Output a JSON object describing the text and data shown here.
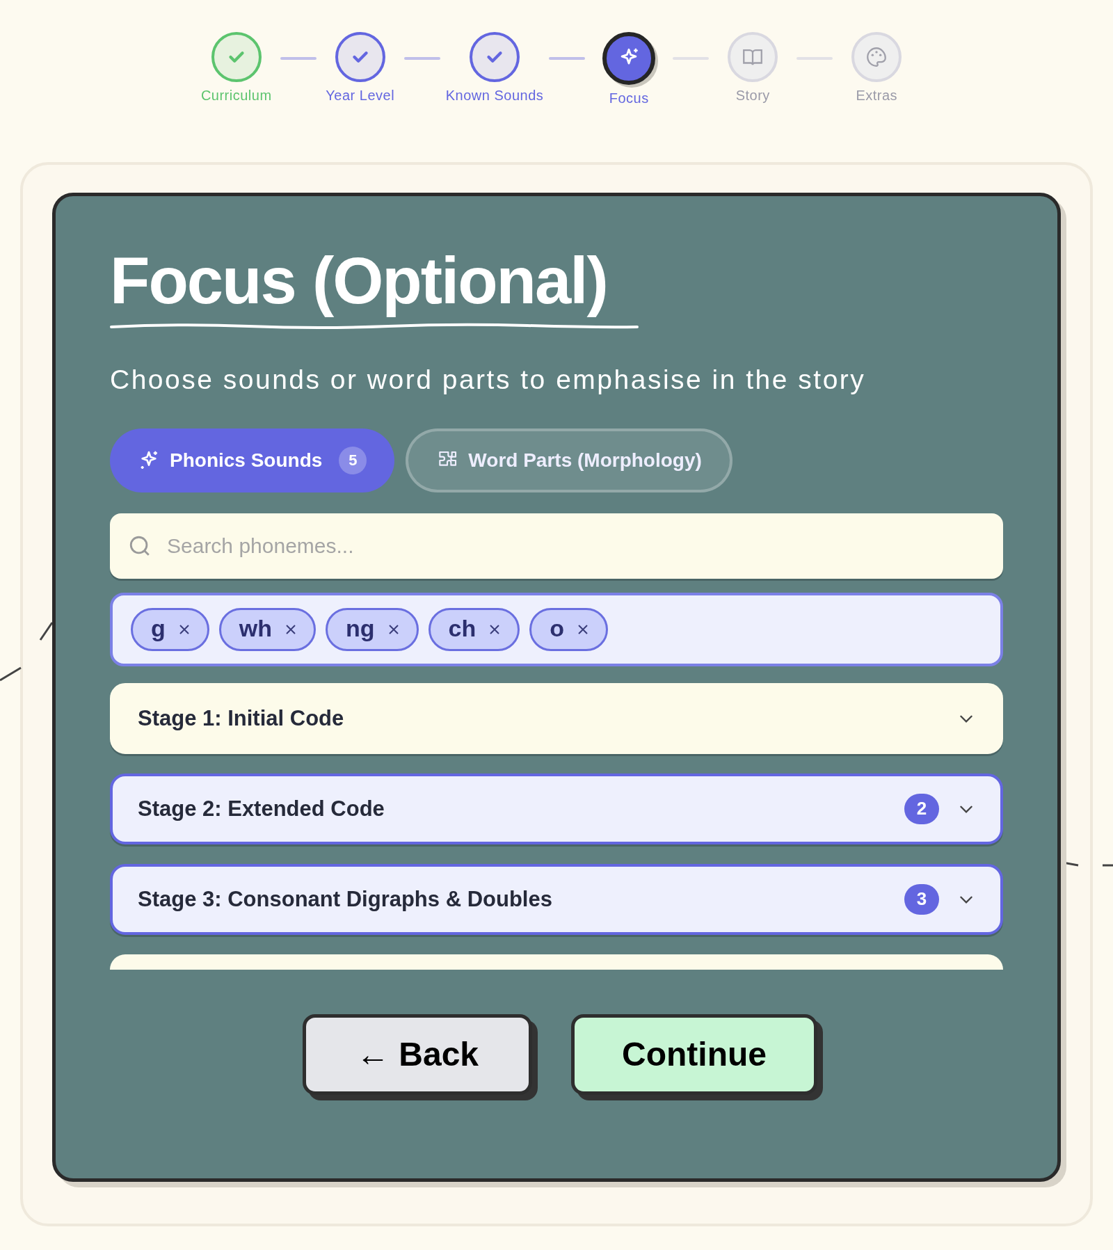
{
  "steps": [
    {
      "label": "Curriculum",
      "completed": true,
      "selected": false,
      "color": "#5cc46e"
    },
    {
      "label": "Year Level",
      "completed": true,
      "selected": false,
      "color": "#6366e0"
    },
    {
      "label": "Known Sounds",
      "completed": true,
      "selected": false,
      "color": "#6366e0"
    },
    {
      "label": "Focus",
      "completed": false,
      "selected": true,
      "color": "#6366e0"
    },
    {
      "label": "Story",
      "completed": false,
      "selected": false,
      "color": "#d9d8e0"
    },
    {
      "label": "Extras",
      "completed": false,
      "selected": false,
      "color": "#d9d8e0"
    }
  ],
  "title": "Focus (Optional)",
  "subtitle": "Choose sounds or word parts to emphasise in the story",
  "tabs": [
    {
      "label": "Phonics Sounds",
      "count": "5",
      "selected": true
    },
    {
      "label": "Word Parts (Morphology)",
      "selected": false
    }
  ],
  "search": {
    "placeholder": "Search phonemes..."
  },
  "chips": [
    {
      "label": "g"
    },
    {
      "label": "wh"
    },
    {
      "label": "ng"
    },
    {
      "label": "ch"
    },
    {
      "label": "o"
    }
  ],
  "stages": [
    {
      "label": "Stage 1: Initial Code",
      "active": false
    },
    {
      "label": "Stage 2: Extended Code",
      "count": "2",
      "active": true
    },
    {
      "label": "Stage 3: Consonant Digraphs & Doubles",
      "count": "3",
      "active": true
    }
  ],
  "buttons": {
    "back": "← Back",
    "continue": "Continue"
  }
}
